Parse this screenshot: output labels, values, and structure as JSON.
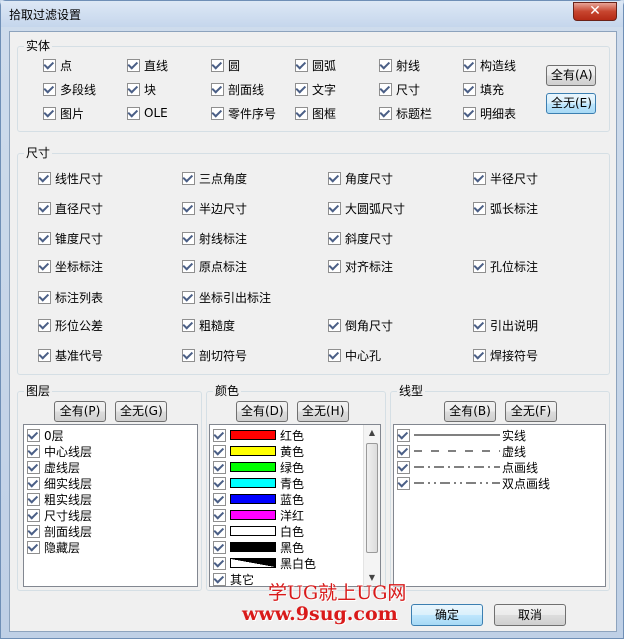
{
  "window": {
    "title": "拾取过滤设置",
    "close_label": "✕"
  },
  "entity": {
    "title": "实体",
    "items": [
      {
        "label": "点",
        "checked": true
      },
      {
        "label": "直线",
        "checked": true
      },
      {
        "label": "圆",
        "checked": true
      },
      {
        "label": "圆弧",
        "checked": true
      },
      {
        "label": "射线",
        "checked": true
      },
      {
        "label": "构造线",
        "checked": true
      },
      {
        "label": "多段线",
        "checked": true
      },
      {
        "label": "块",
        "checked": true
      },
      {
        "label": "剖面线",
        "checked": true
      },
      {
        "label": "文字",
        "checked": true
      },
      {
        "label": "尺寸",
        "checked": true
      },
      {
        "label": "填充",
        "checked": true
      },
      {
        "label": "图片",
        "checked": true
      },
      {
        "label": "OLE",
        "checked": true
      },
      {
        "label": "零件序号",
        "checked": true
      },
      {
        "label": "图框",
        "checked": true
      },
      {
        "label": "标题栏",
        "checked": true
      },
      {
        "label": "明细表",
        "checked": true
      }
    ],
    "all_on": "全有(A)",
    "all_off": "全无(E)"
  },
  "dimension": {
    "title": "尺寸",
    "items": [
      {
        "label": "线性尺寸",
        "checked": true
      },
      {
        "label": "三点角度",
        "checked": true
      },
      {
        "label": "角度尺寸",
        "checked": true
      },
      {
        "label": "半径尺寸",
        "checked": true
      },
      {
        "label": "直径尺寸",
        "checked": true
      },
      {
        "label": "半边尺寸",
        "checked": true
      },
      {
        "label": "大圆弧尺寸",
        "checked": true
      },
      {
        "label": "弧长标注",
        "checked": true
      },
      {
        "label": "锥度尺寸",
        "checked": true
      },
      {
        "label": "射线标注",
        "checked": true
      },
      {
        "label": "斜度尺寸",
        "checked": true
      },
      {
        "label": "坐标标注",
        "checked": true
      },
      {
        "label": "原点标注",
        "checked": true
      },
      {
        "label": "对齐标注",
        "checked": true
      },
      {
        "label": "孔位标注",
        "checked": true
      },
      {
        "label": "标注列表",
        "checked": true
      },
      {
        "label": "坐标引出标注",
        "checked": true
      },
      {
        "label": "形位公差",
        "checked": true
      },
      {
        "label": "粗糙度",
        "checked": true
      },
      {
        "label": "倒角尺寸",
        "checked": true
      },
      {
        "label": "引出说明",
        "checked": true
      },
      {
        "label": "基准代号",
        "checked": true
      },
      {
        "label": "剖切符号",
        "checked": true
      },
      {
        "label": "中心孔",
        "checked": true
      },
      {
        "label": "焊接符号",
        "checked": true
      }
    ]
  },
  "layer": {
    "title": "图层",
    "all_on": "全有(P)",
    "all_off": "全无(G)",
    "items": [
      {
        "label": "0层",
        "checked": true
      },
      {
        "label": "中心线层",
        "checked": true
      },
      {
        "label": "虚线层",
        "checked": true
      },
      {
        "label": "细实线层",
        "checked": true
      },
      {
        "label": "粗实线层",
        "checked": true
      },
      {
        "label": "尺寸线层",
        "checked": true
      },
      {
        "label": "剖面线层",
        "checked": true
      },
      {
        "label": "隐藏层",
        "checked": true
      }
    ]
  },
  "color": {
    "title": "颜色",
    "all_on": "全有(D)",
    "all_off": "全无(H)",
    "items": [
      {
        "label": "红色",
        "color": "#ff0000",
        "checked": true
      },
      {
        "label": "黄色",
        "color": "#ffff00",
        "checked": true
      },
      {
        "label": "绿色",
        "color": "#00ff00",
        "checked": true
      },
      {
        "label": "青色",
        "color": "#00ffff",
        "checked": true
      },
      {
        "label": "蓝色",
        "color": "#0000ff",
        "checked": true
      },
      {
        "label": "洋红",
        "color": "#ff00ff",
        "checked": true
      },
      {
        "label": "白色",
        "color": "#ffffff",
        "checked": true
      },
      {
        "label": "黑色",
        "color": "#000000",
        "checked": true
      },
      {
        "label": "黑白色",
        "color": "bw",
        "checked": true
      },
      {
        "label": "其它",
        "color": "",
        "checked": true
      }
    ]
  },
  "linetype": {
    "title": "线型",
    "all_on": "全有(B)",
    "all_off": "全无(F)",
    "items": [
      {
        "label": "实线",
        "pattern": "solid",
        "checked": true
      },
      {
        "label": "虚线",
        "pattern": "dash",
        "checked": true
      },
      {
        "label": "点画线",
        "pattern": "dashdot",
        "checked": true
      },
      {
        "label": "双点画线",
        "pattern": "dashdotdot",
        "checked": true
      }
    ]
  },
  "footer": {
    "ok": "确定",
    "cancel": "取消"
  },
  "watermark": {
    "line1": "学UG就上UG网",
    "line2": "www.9sug.com"
  }
}
